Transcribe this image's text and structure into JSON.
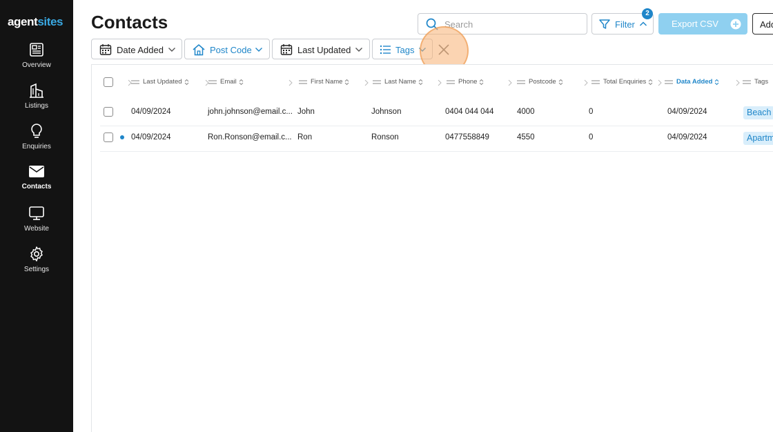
{
  "app": {
    "logo_part1": "agent",
    "logo_part2": "sites"
  },
  "sidebar": {
    "items": [
      {
        "label": "Overview",
        "icon": "newspaper-icon"
      },
      {
        "label": "Listings",
        "icon": "building-icon"
      },
      {
        "label": "Enquiries",
        "icon": "lightbulb-icon"
      },
      {
        "label": "Contacts",
        "icon": "envelope-icon",
        "active": true
      },
      {
        "label": "Website",
        "icon": "monitor-icon"
      },
      {
        "label": "Settings",
        "icon": "gear-icon"
      }
    ]
  },
  "header": {
    "title": "Contacts",
    "search_placeholder": "Search",
    "filter_label": "Filter",
    "filter_count": "2",
    "export_label": "Export CSV",
    "add_label": "Add"
  },
  "filters": {
    "chips": [
      {
        "label": "Date Added",
        "icon": "calendar-icon"
      },
      {
        "label": "Post Code",
        "icon": "house-icon"
      },
      {
        "label": "Last Updated",
        "icon": "calendar-icon"
      },
      {
        "label": "Tags",
        "icon": "list-icon"
      }
    ]
  },
  "table": {
    "columns": [
      "Last Updated",
      "Email",
      "First Name",
      "Last Name",
      "Phone",
      "Postcode",
      "Total Enquiries",
      "Data Added",
      "Tags"
    ],
    "active_column": "Data Added",
    "rows": [
      {
        "last_updated": "04/09/2024",
        "email": "john.johnson@email.c...",
        "first_name": "John",
        "last_name": "Johnson",
        "phone": "0404 044 044",
        "postcode": "4000",
        "total_enquiries": "0",
        "date_added": "04/09/2024",
        "tag": "Beach",
        "unread": false
      },
      {
        "last_updated": "04/09/2024",
        "email": "Ron.Ronson@email.c...",
        "first_name": "Ron",
        "last_name": "Ronson",
        "phone": "0477558849",
        "postcode": "4550",
        "total_enquiries": "0",
        "date_added": "04/09/2024",
        "tag": "Apartm",
        "unread": true
      }
    ]
  },
  "colors": {
    "accent": "#1f86c9",
    "sidebar_bg": "#131313",
    "export_bg": "#8fd0f0",
    "tag_bg": "#d9eefb"
  }
}
